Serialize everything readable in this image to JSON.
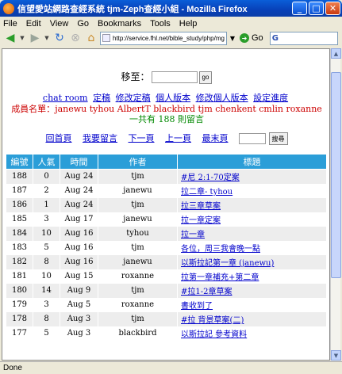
{
  "window": {
    "title": "信望愛站網路查經系統 tjm-Zeph查經小組 - Mozilla Firefox"
  },
  "menu": [
    "File",
    "Edit",
    "View",
    "Go",
    "Bookmarks",
    "Tools",
    "Help"
  ],
  "nav": {
    "url": "http://service.fhl.net/bible_study/php/mg",
    "go_label": "Go",
    "search_glyph": "G"
  },
  "page": {
    "goto_label": "移至：",
    "goto_button": "go",
    "links": [
      "chat room",
      "定稿",
      "修改定稿",
      "個人版本",
      "修改個人版本",
      "設定進度"
    ],
    "members_label": "成員名單：",
    "members": "janewu tyhou AlbertT blackbird tjm chenkent cmlin roxanne",
    "count_text": "一共有 188 則留言",
    "pager": [
      "回首頁",
      "我要留言",
      "下一頁",
      "上一頁",
      "最末頁"
    ],
    "search_button": "搜尋"
  },
  "table": {
    "headers": [
      "編號",
      "人氣",
      "時間",
      "作者",
      "標題"
    ],
    "rows": [
      [
        "188",
        "0",
        "Aug 24",
        "tjm",
        "#尼 2:1-70定案"
      ],
      [
        "187",
        "2",
        "Aug 24",
        "janewu",
        "拉二章- tyhou"
      ],
      [
        "186",
        "1",
        "Aug 24",
        "tjm",
        "拉三章草案"
      ],
      [
        "185",
        "3",
        "Aug 17",
        "janewu",
        "拉一章定案"
      ],
      [
        "184",
        "10",
        "Aug 16",
        "tyhou",
        "拉一章"
      ],
      [
        "183",
        "5",
        "Aug 16",
        "tjm",
        "各位，周三我會晚一點"
      ],
      [
        "182",
        "8",
        "Aug 16",
        "janewu",
        "以斯拉記第一章 (janewu)"
      ],
      [
        "181",
        "10",
        "Aug 15",
        "roxanne",
        "拉第一章補充+第二章"
      ],
      [
        "180",
        "14",
        "Aug 9",
        "tjm",
        "#拉1-2章草案"
      ],
      [
        "179",
        "3",
        "Aug 5",
        "roxanne",
        "書收到了"
      ],
      [
        "178",
        "8",
        "Aug 3",
        "tjm",
        "#拉 背景草案(二)"
      ],
      [
        "177",
        "5",
        "Aug 3",
        "blackbird",
        "以斯拉記 參考資料"
      ]
    ]
  },
  "status": "Done"
}
